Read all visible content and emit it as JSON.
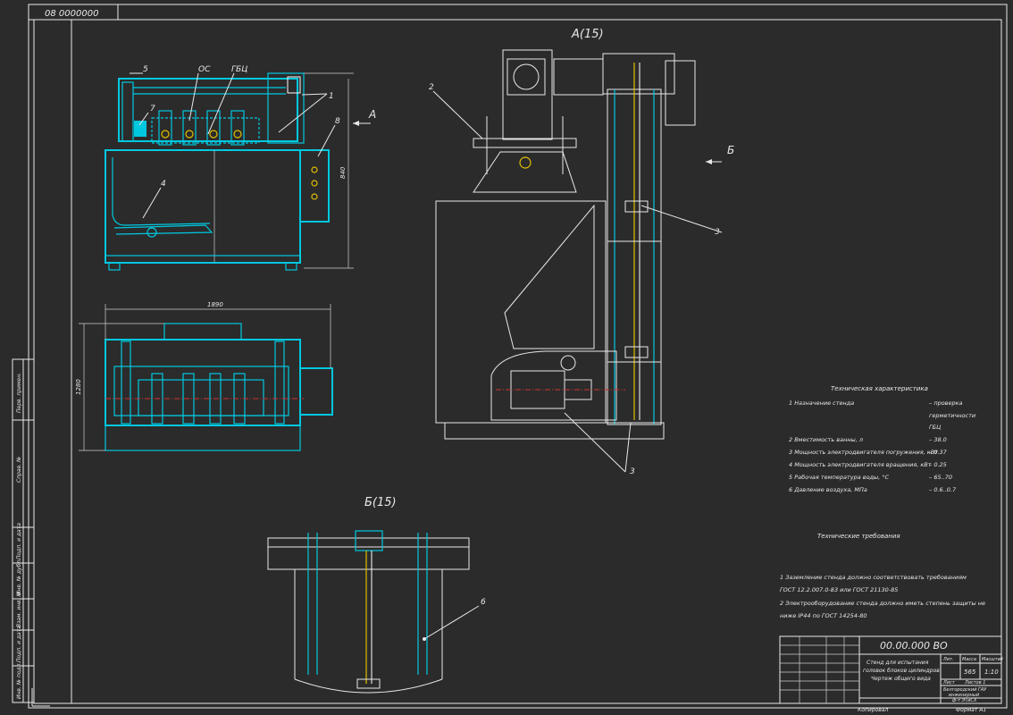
{
  "sheet": {
    "code_top": "08 0000000"
  },
  "views": {
    "view_a_title": "А(15)",
    "view_b_title": "Б(15)",
    "arrow_a": "А",
    "arrow_b": "Б"
  },
  "callouts": {
    "c1": "1",
    "c2": "2",
    "c3a": "3",
    "c3b": "3",
    "c4": "4",
    "c5": "5",
    "c6": "6",
    "c7": "7",
    "c8": "8",
    "oc": "ОС",
    "gbc": "ГБЦ"
  },
  "dimensions": {
    "height": "840",
    "width": "1890",
    "depth": "1280"
  },
  "tech_char": {
    "title": "Техническая характеристика",
    "rows": [
      {
        "left": "1  Назначение стенда",
        "right": "– проверка"
      },
      {
        "left": "",
        "right": "герметичности"
      },
      {
        "left": "",
        "right": "ГБЦ"
      },
      {
        "left": "2  Вместимость ванны, л",
        "right": "– 38.0"
      },
      {
        "left": "3  Мощность электродвигателя погружения, кВт",
        "right": "– 0.37"
      },
      {
        "left": "4  Мощность электродвигателя вращения, кВт",
        "right": "– 0.25"
      },
      {
        "left": "5  Рабочая температура воды, °С",
        "right": "– 65..70"
      },
      {
        "left": "6  Давление воздуха, МПа",
        "right": "– 0.6..0.7"
      }
    ]
  },
  "tech_req": {
    "title": "Технические требования",
    "lines": [
      "1 Заземление стенда должно соответствовать требованиям",
      "ГОСТ 12.2.007.0-83 или ГОСТ 21130-85",
      "2 Электрооборудование стенда должно иметь степень защиты не",
      "ниже IP44 по ГОСТ 14254-80"
    ]
  },
  "title_block": {
    "doc_code": "00.00.000 ВО",
    "name_line1": "Стенд для испытания",
    "name_line2": "головок блоков цилиндров",
    "name_line3": "Чертеж общего вида",
    "col_lit": "Лит.",
    "col_mass": "Масса",
    "col_scale": "Масштаб",
    "mass": "565",
    "scale": "1:10",
    "sheet": "Лист",
    "sheets": "Листов  1",
    "org_line1": "Белгородский ГАУ",
    "org_line2": "инженерный",
    "org_line3": "ф-т ЭТиСХ",
    "copied": "Копировал",
    "format": "Формат   А1"
  },
  "side_stamp": {
    "s1": "Перв. примен.",
    "s2": "Справ. №",
    "s3": "Подп. и дата",
    "s4": "Инв. № дубл.",
    "s5": "Взам. инв. №",
    "s6": "Подп. и дата",
    "s7": "Инв. № подл."
  },
  "colors": {
    "background": "#2b2b2b",
    "linework": "#e8e8e8",
    "parts": "#00c8e0",
    "center": "#d03030",
    "highlight": "#e0c000"
  }
}
